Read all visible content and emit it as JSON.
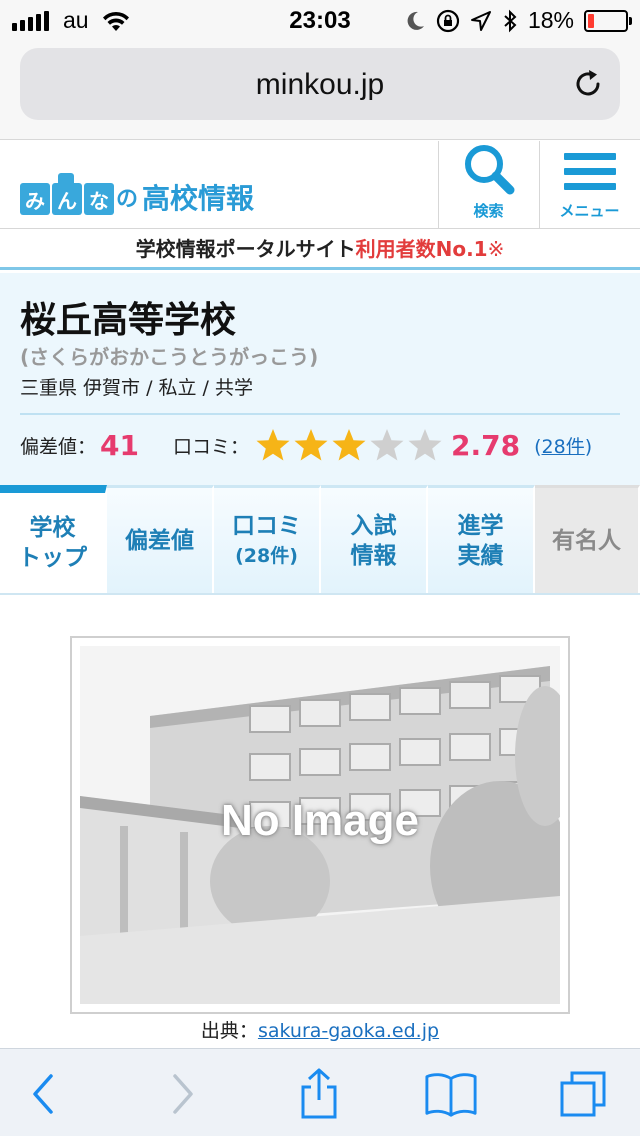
{
  "status_bar": {
    "carrier": "au",
    "time": "23:03",
    "battery_percent": "18%",
    "battery_level": 0.18,
    "battery_color": "#ff3b30"
  },
  "browser": {
    "url": "minkou.jp",
    "reload_icon": "reload-icon"
  },
  "site_header": {
    "logo_tiles": [
      "み",
      "ん",
      "な"
    ],
    "logo_tile_colors": [
      "#39a8dc",
      "#39a8dc",
      "#39a8dc"
    ],
    "logo_no": "の",
    "logo_text": "高校情報",
    "search_label": "検索",
    "menu_label": "メニュー",
    "accent_color": "#1a9ad6"
  },
  "tagline": {
    "text": "学校情報ポータルサイト",
    "highlight": "利用者数No.1",
    "mark": "※"
  },
  "school": {
    "name": "桜丘高等学校",
    "kana": "(さくらがおかこうとうがっこう)",
    "meta": "三重県 伊賀市 / 私立 / 共学",
    "hensachi_label": "偏差値：",
    "hensachi_value": "41",
    "kuchikomi_label": "口コミ：",
    "rating_value": "2.78",
    "rating_stars": 2.78,
    "count_open": "(",
    "count_link": "28件",
    "count_close": ")"
  },
  "tabs": [
    {
      "line1": "学校",
      "line2": "トップ"
    },
    {
      "line1": "偏差値",
      "line2": ""
    },
    {
      "line1": "口コミ",
      "line2": "(28件)"
    },
    {
      "line1": "入試",
      "line2": "情報"
    },
    {
      "line1": "進学",
      "line2": "実績"
    },
    {
      "line1": "有名人",
      "line2": ""
    }
  ],
  "photo": {
    "placeholder_text": "No Image",
    "credit_label": "出典：",
    "credit_link": "sakura-gaoka.ed.jp"
  },
  "toolbar": {
    "icons": [
      "back-icon",
      "forward-icon",
      "share-icon",
      "bookmarks-icon",
      "tabs-icon"
    ]
  }
}
